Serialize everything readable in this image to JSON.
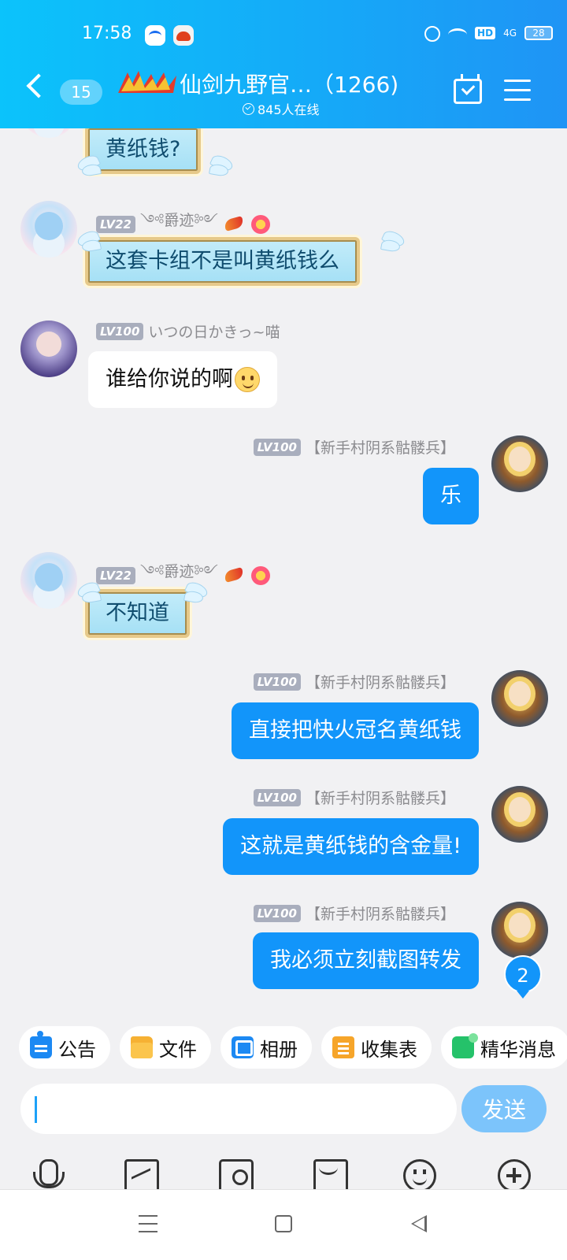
{
  "status_bar": {
    "time": "17:58",
    "hd": "HD",
    "network": "4G",
    "battery": "28"
  },
  "header": {
    "unread": "15",
    "title": "仙剑九野官…（1266)",
    "online": "845人在线"
  },
  "messages": [
    {
      "sender": "",
      "level": "",
      "text": "黄纸钱?"
    },
    {
      "sender": "༺爵迹༻",
      "level": "LV22",
      "text": "这套卡组不是叫黄纸钱么"
    },
    {
      "sender": "いつの日かきっ~喵",
      "level": "LV100",
      "text": "谁给你说的啊"
    },
    {
      "sender": "【新手村阴系骷髅兵】",
      "level": "LV100",
      "text": "乐"
    },
    {
      "sender": "༺爵迹༻",
      "level": "LV22",
      "text": "不知道"
    },
    {
      "sender": "【新手村阴系骷髅兵】",
      "level": "LV100",
      "text": "直接把快火冠名黄纸钱"
    },
    {
      "sender": "【新手村阴系骷髅兵】",
      "level": "LV100",
      "text": "这就是黄纸钱的含金量!"
    },
    {
      "sender": "【新手村阴系骷髅兵】",
      "level": "LV100",
      "text": "我必须立刻截图转发"
    }
  ],
  "new_message_count": "2",
  "quick_tools": [
    {
      "label": "公告",
      "icon": "notice-icon"
    },
    {
      "label": "文件",
      "icon": "folder-icon"
    },
    {
      "label": "相册",
      "icon": "album-icon"
    },
    {
      "label": "收集表",
      "icon": "collect-form-icon"
    },
    {
      "label": "精华消息",
      "icon": "essence-icon"
    }
  ],
  "input": {
    "value": "",
    "send_label": "发送"
  },
  "toolbar_icons": [
    "microphone-icon",
    "image-icon",
    "camera-icon",
    "red-packet-icon",
    "emoji-icon",
    "plus-icon"
  ],
  "colors": {
    "header_start": "#0bc3fb",
    "header_end": "#1f94f5",
    "bubble_blue": "#1295fa",
    "send_disabled": "#7cc4fb",
    "background": "#f1f1f3"
  }
}
